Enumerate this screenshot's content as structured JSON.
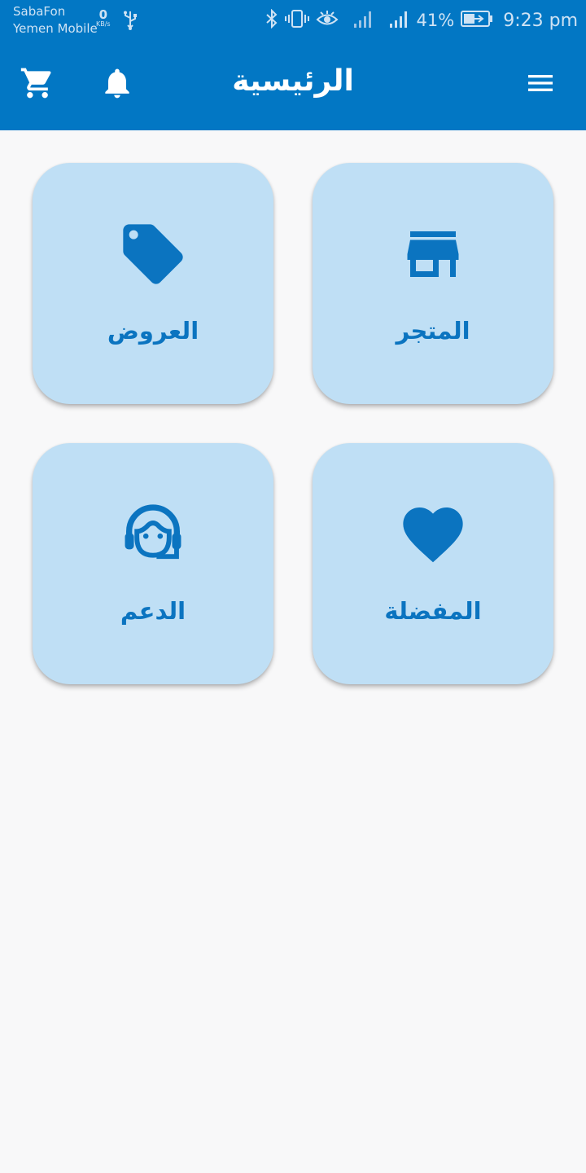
{
  "status_bar": {
    "carrier_1": "SabaFon",
    "carrier_2": "Yemen Mobile",
    "speed_value": "0",
    "speed_unit": "KB/s",
    "battery_percent": "41%",
    "time": "9:23 pm"
  },
  "app_bar": {
    "title": "الرئيسية",
    "icons": [
      "menu-icon",
      "bell-icon",
      "cart-icon"
    ]
  },
  "tiles": [
    {
      "label": "المتجر",
      "icon": "store-icon"
    },
    {
      "label": "العروض",
      "icon": "tag-icon"
    },
    {
      "label": "المفضلة",
      "icon": "heart-icon"
    },
    {
      "label": "الدعم",
      "icon": "support-agent-icon"
    }
  ],
  "colors": {
    "primary": "#0277c4",
    "tile_background": "#bfdff5",
    "tile_foreground": "#0b74c0",
    "page_background": "#f8f8f9"
  }
}
